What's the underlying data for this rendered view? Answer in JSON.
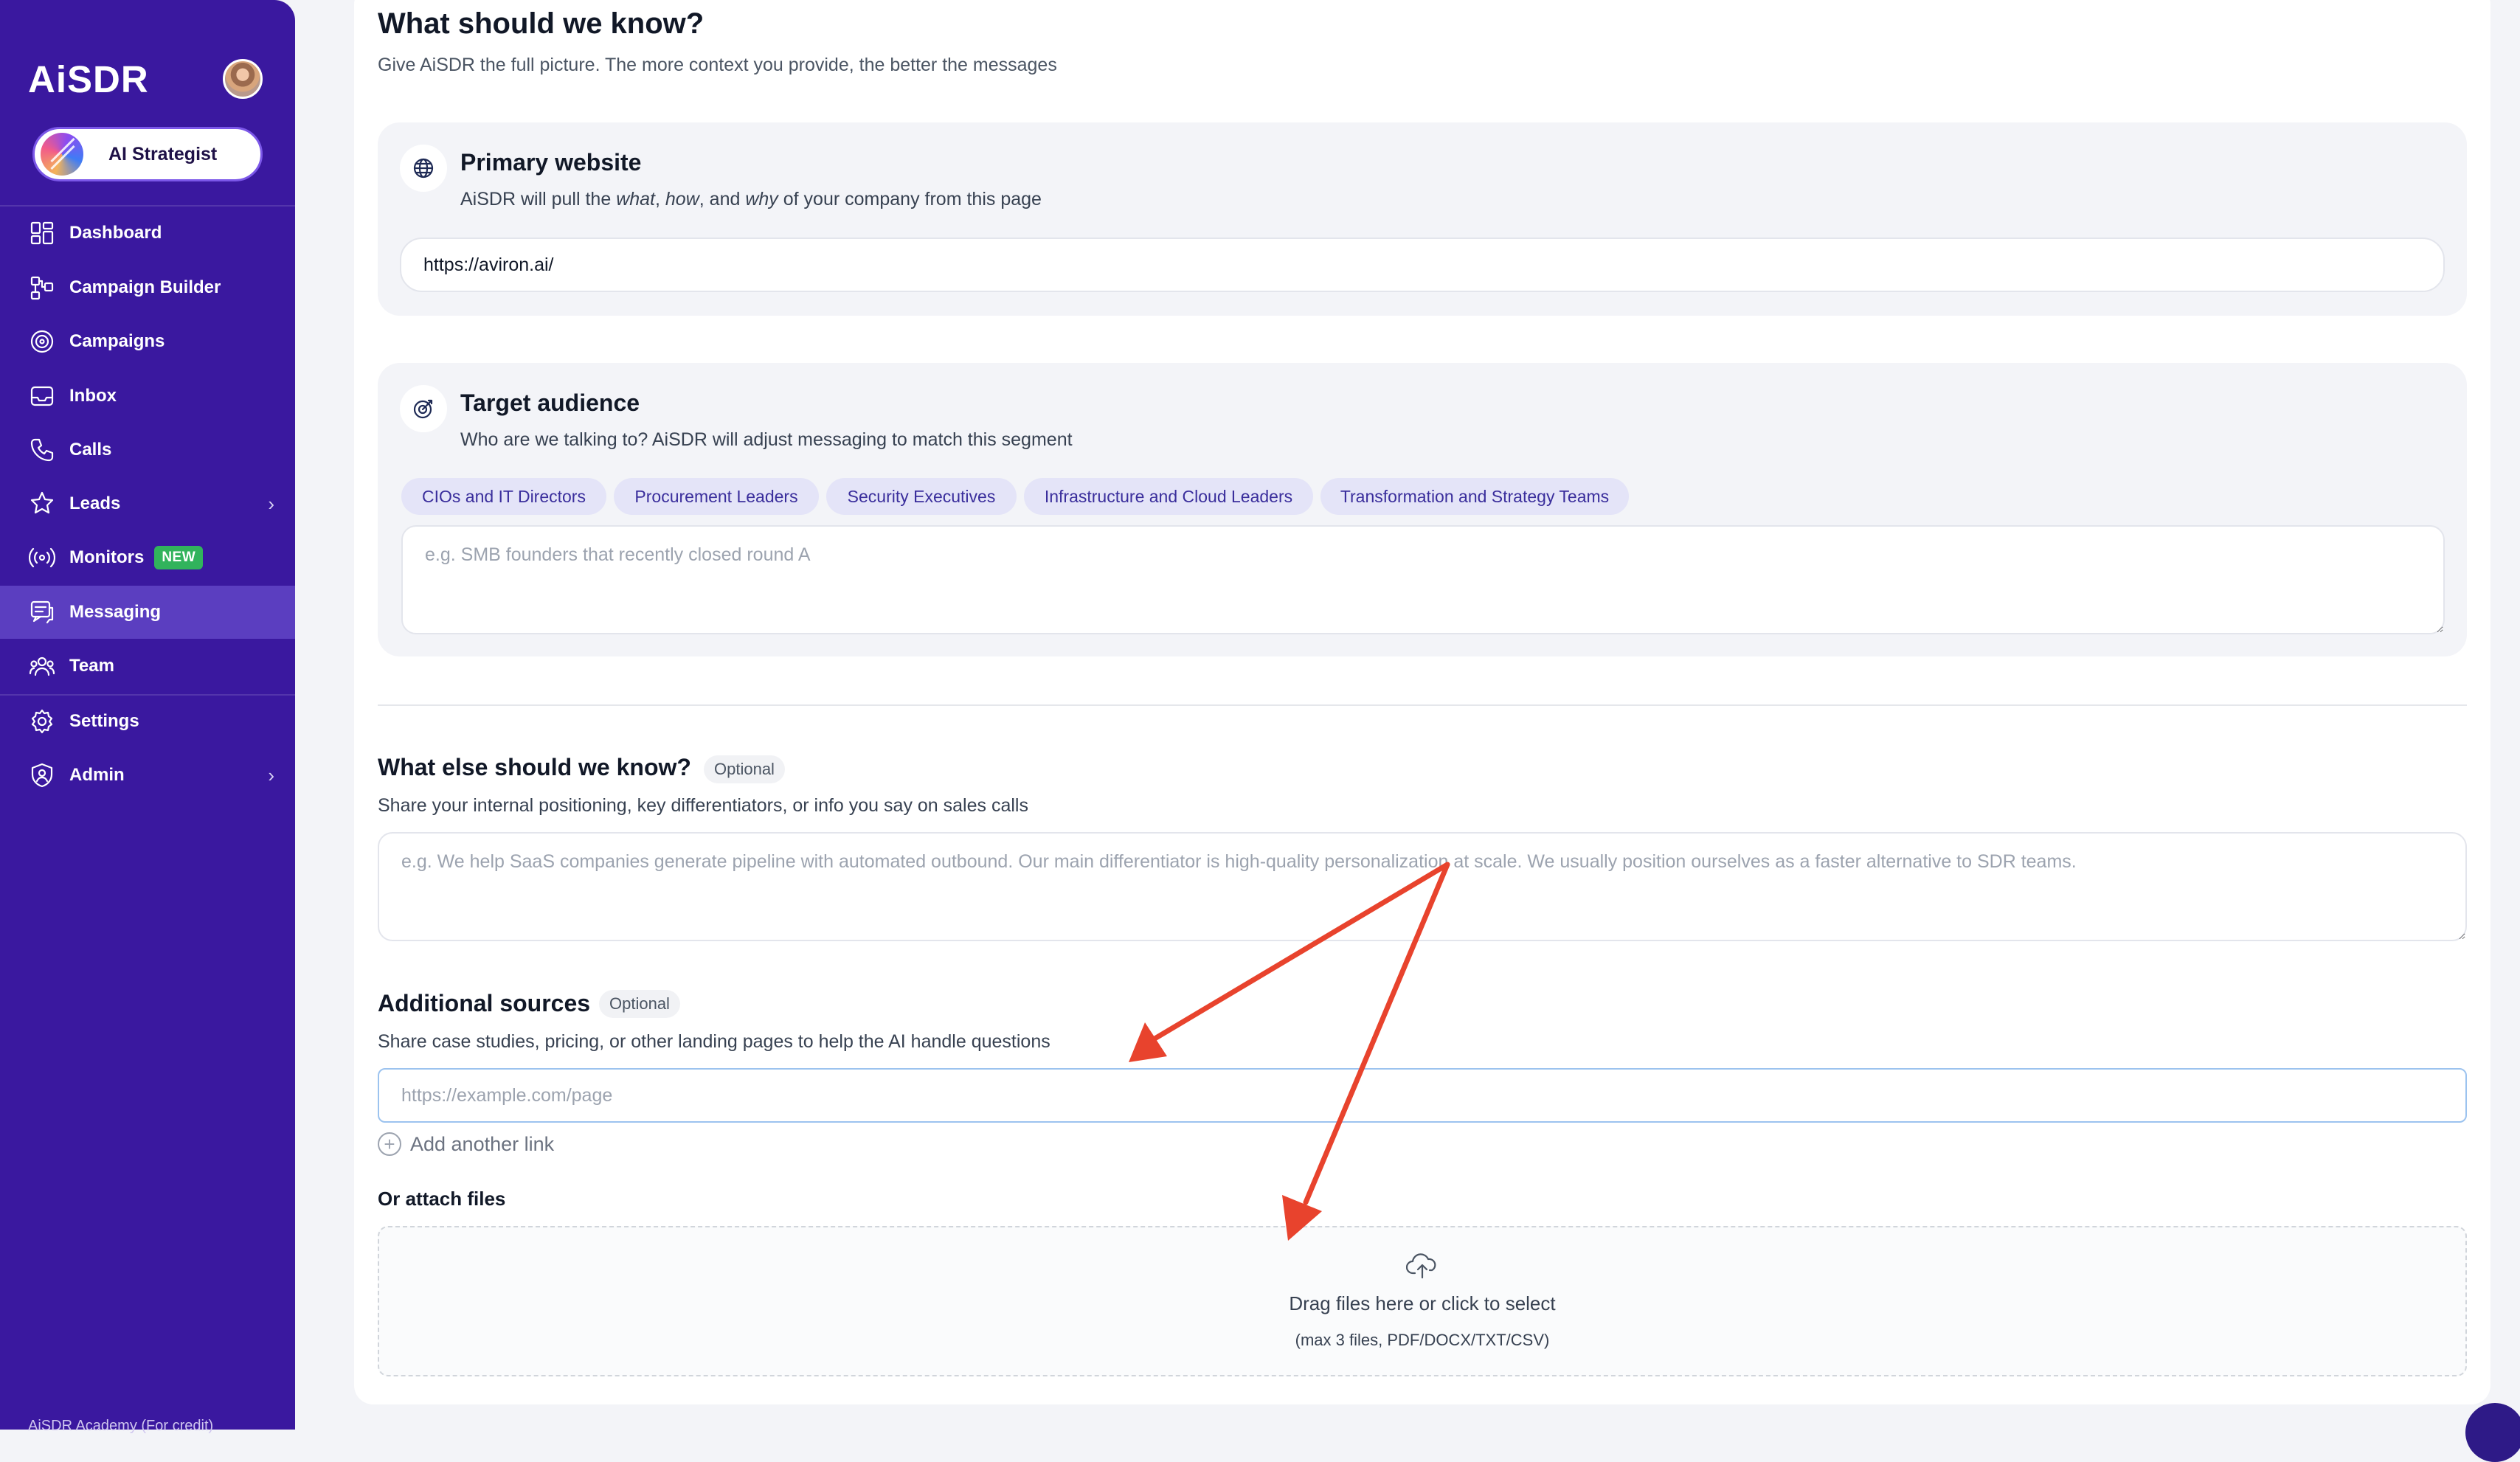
{
  "sidebar": {
    "brand": "AiSDR",
    "strategist_label": "AI Strategist",
    "items": [
      {
        "label": "Dashboard",
        "icon": "dashboard-icon"
      },
      {
        "label": "Campaign Builder",
        "icon": "campaign-builder-icon"
      },
      {
        "label": "Campaigns",
        "icon": "target-icon"
      },
      {
        "label": "Inbox",
        "icon": "inbox-icon"
      },
      {
        "label": "Calls",
        "icon": "phone-icon"
      },
      {
        "label": "Leads",
        "icon": "star-user-icon",
        "has_submenu": true
      },
      {
        "label": "Monitors",
        "icon": "broadcast-icon",
        "badge": "NEW"
      },
      {
        "label": "Messaging",
        "icon": "chat-icon",
        "active": true
      },
      {
        "label": "Team",
        "icon": "team-icon"
      },
      {
        "label": "Settings",
        "icon": "gear-icon"
      },
      {
        "label": "Admin",
        "icon": "shield-user-icon",
        "has_submenu": true
      }
    ],
    "footer": "AiSDR Academy (For credit)",
    "active_color": "#5b3ec0",
    "bg_color": "#3a189f"
  },
  "main": {
    "title": "What should we know?",
    "subtitle": "Give AiSDR the full picture. The more context you provide, the better the messages",
    "primary_website": {
      "icon": "globe-icon",
      "title": "Primary website",
      "subtitle_parts": [
        "AiSDR will pull the ",
        "what",
        ", ",
        "how",
        ", and ",
        "why",
        " of your company from this page"
      ],
      "value": "https://aviron.ai/"
    },
    "target_audience": {
      "icon": "target-arrow-icon",
      "title": "Target audience",
      "subtitle": "Who are we talking to? AiSDR will adjust messaging to match this segment",
      "chips": [
        "CIOs and IT Directors",
        "Procurement Leaders",
        "Security Executives",
        "Infrastructure and Cloud Leaders",
        "Transformation and Strategy Teams"
      ],
      "placeholder": "e.g. SMB founders that recently closed round A"
    },
    "what_else": {
      "title": "What else should we know?",
      "badge": "Optional",
      "subtitle": "Share your internal positioning, key differentiators, or info you say on sales calls",
      "placeholder": "e.g. We help SaaS companies generate pipeline with automated outbound. Our main differentiator is high-quality personalization at scale. We usually position ourselves as a faster alternative to SDR teams."
    },
    "additional_sources": {
      "title": "Additional sources",
      "badge": "Optional",
      "subtitle": "Share case studies, pricing, or other landing pages to help the AI handle questions",
      "placeholder": "https://example.com/page",
      "add_link_label": "Add another link",
      "attach_label": "Or attach files",
      "dropzone_text": "Drag files here or click to select",
      "dropzone_hint": "(max 3 files, PDF/DOCX/TXT/CSV)",
      "upload_icon": "upload-cloud-icon"
    }
  },
  "annotation": {
    "arrow_color": "#e8432d"
  }
}
